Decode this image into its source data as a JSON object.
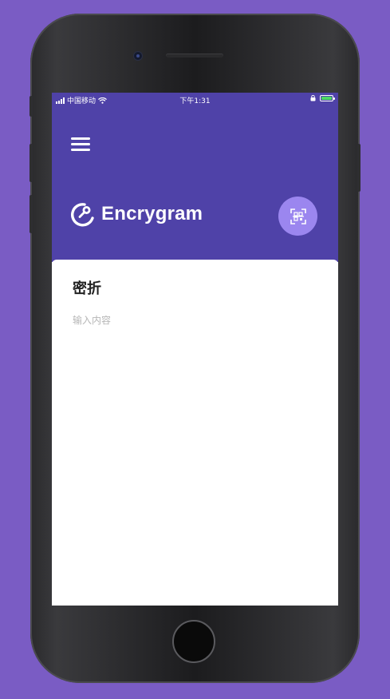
{
  "status_bar": {
    "carrier": "中国移动",
    "time": "下午1:31"
  },
  "app": {
    "name": "Encrygram",
    "accent_color": "#4f42a8",
    "scan_button_color": "#9b86ef"
  },
  "note": {
    "title": "密折",
    "input_placeholder": "输入内容",
    "input_value": ""
  },
  "icons": {
    "menu": "hamburger-menu-icon",
    "logo": "encrygram-logo-icon",
    "scan": "scan-qr-icon"
  }
}
